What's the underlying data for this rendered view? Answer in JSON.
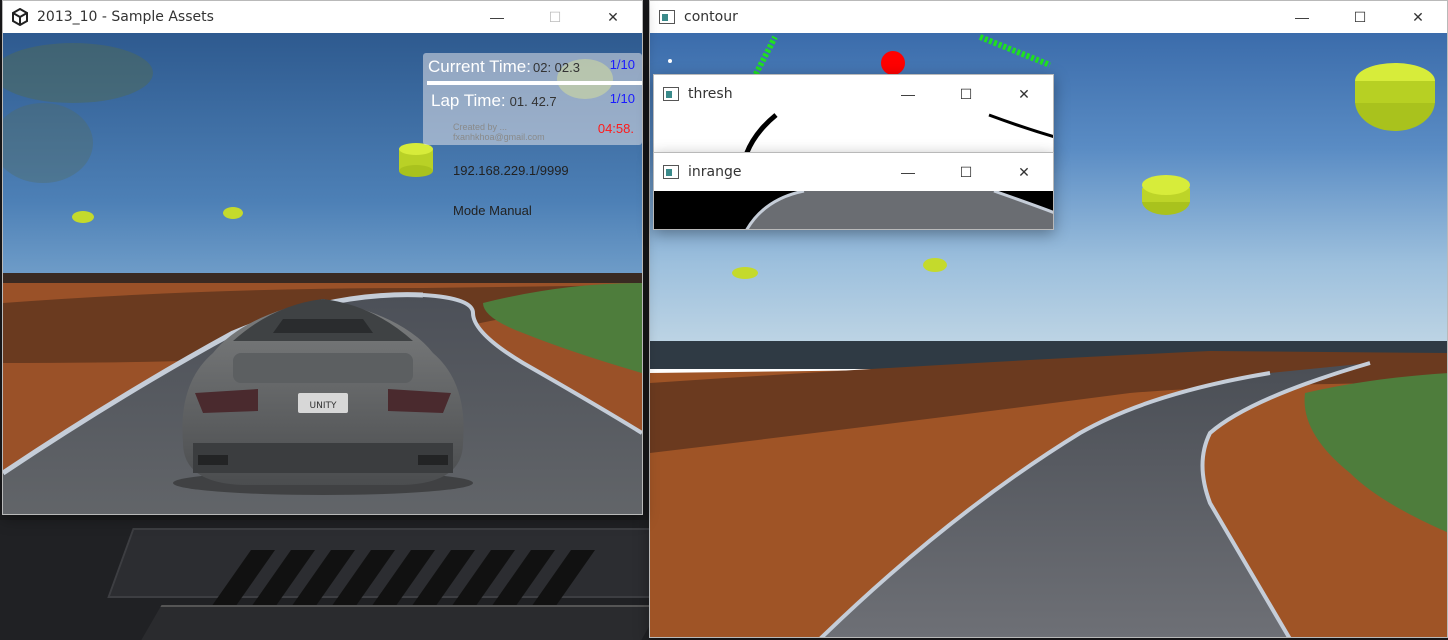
{
  "unity_window": {
    "title": "2013_10 - Sample Assets",
    "hud": {
      "current_time_label": "Current Time:",
      "current_time_value": "02: 02.3",
      "current_lap": "1/10",
      "lap_time_label": "Lap Time:",
      "lap_time_value": "01. 42.7",
      "lap_count": "1/10",
      "credit_line1": "Created by ...",
      "credit_line2": "fxanhkhoa@gmail.com",
      "countdown": "04:58."
    },
    "ip_address": "192.168.229.1/9999",
    "mode": "Mode Manual",
    "license_plate": "UNITY"
  },
  "contour_window": {
    "title": "contour"
  },
  "thresh_window": {
    "title": "thresh"
  },
  "inrange_window": {
    "title": "inrange"
  },
  "window_controls": {
    "minimize": "—",
    "maximize": "☐",
    "close": "✕"
  },
  "colors": {
    "road": "#56595d",
    "dirt": "#a5582a",
    "grass": "#4e7d3c",
    "target_dot": "#ff0000",
    "track_line": "#1fe01f",
    "cone": "#c9e02a"
  }
}
